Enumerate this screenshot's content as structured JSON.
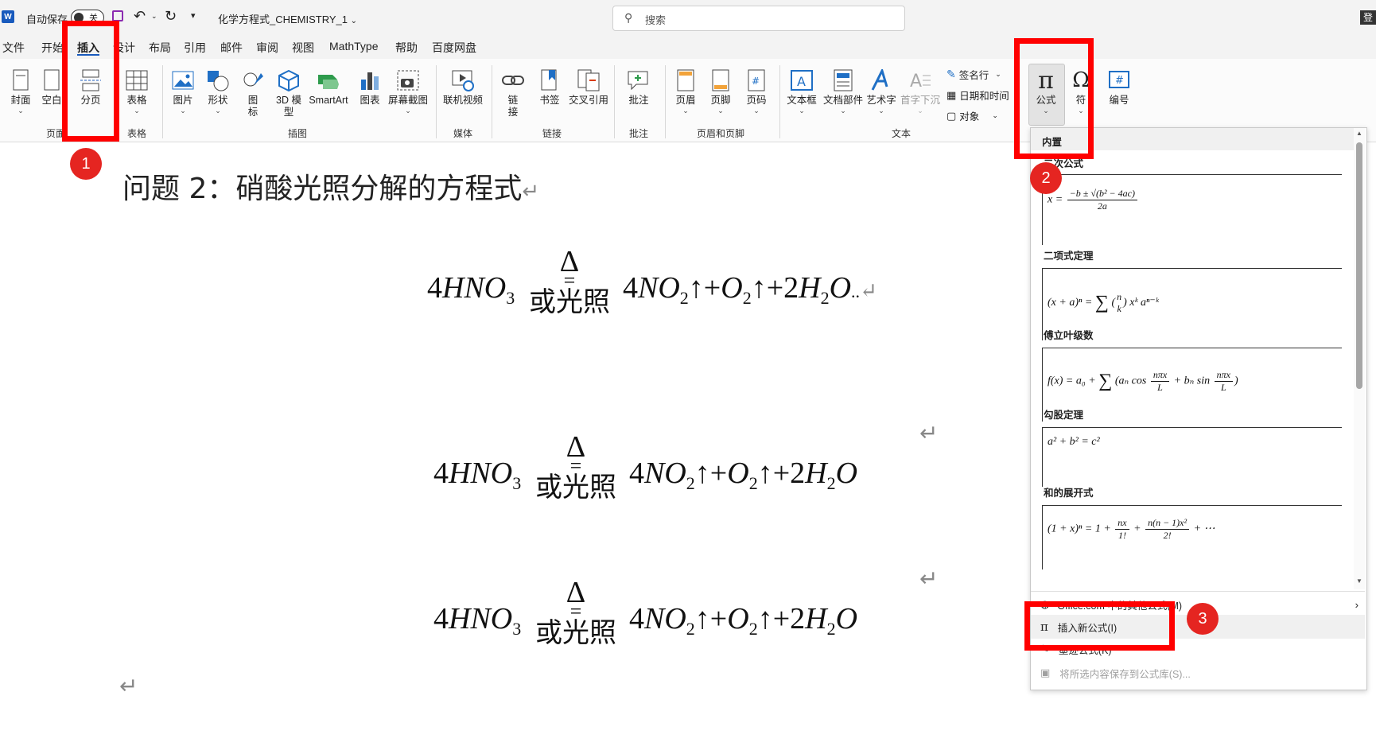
{
  "titlebar": {
    "autosave_label": "自动保存",
    "autosave_state": "关",
    "doc_title": "化学方程式_CHEMISTRY_1",
    "search_placeholder": "搜索",
    "login": "登"
  },
  "menu": {
    "items": [
      "文件",
      "开始",
      "插入",
      "设计",
      "布局",
      "引用",
      "邮件",
      "审阅",
      "视图",
      "MathType",
      "帮助",
      "百度网盘"
    ],
    "active": "插入"
  },
  "ribbon": {
    "buttons": {
      "cover": "封面",
      "blank": "空白",
      "pagebreak": "分页",
      "table": "表格",
      "picture": "图片",
      "shapes": "形状",
      "icons": "图\n标",
      "model3d": "3D 模\n型",
      "smartart": "SmartArt",
      "chart": "图表",
      "screenshot": "屏幕截图",
      "online_video": "联机视频",
      "link": "链\n接",
      "bookmark": "书签",
      "crossref": "交叉引用",
      "comment": "批注",
      "header": "页眉",
      "footer": "页脚",
      "pagenum": "页码",
      "textbox": "文本框",
      "quickparts": "文档部件",
      "wordart": "艺术字",
      "dropcap": "首字下沉",
      "signature": "签名行",
      "datetime": "日期和时间",
      "object": "对象",
      "equation": "公式",
      "symbol": "符",
      "number": "编号"
    },
    "groups": {
      "pages": "页面",
      "tables": "表格",
      "illustrations": "插图",
      "media": "媒体",
      "links": "链接",
      "comments": "批注",
      "header_footer": "页眉和页脚",
      "text": "文本"
    }
  },
  "document": {
    "heading": "问题 2：硝酸光照分解的方程式",
    "condition_top": "Δ",
    "condition_bottom": "或光照",
    "paragraph_mark": "↵",
    "eq1": {
      "reactant_coef": "4",
      "reactant": "HNO",
      "reactant_sub": "3",
      "p1_coef": "4",
      "p1": "NO",
      "p1_sub": "2",
      "arrow": "↑",
      "plus": "+",
      "p2": "O",
      "p2_sub": "2",
      "p3_coef": "2",
      "p3a": "H",
      "p3a_sub": "2",
      "p3b": "O",
      "trail": ".."
    }
  },
  "equation_panel": {
    "header": "内置",
    "sections": [
      {
        "title": "二次公式",
        "formula": "x = (−b ± √(b² − 4ac)) / 2a"
      },
      {
        "title": "二项式定理",
        "formula": "(x + a)ⁿ = Σ (n k) xᵏ aⁿ⁻ᵏ"
      },
      {
        "title": "傅立叶级数",
        "formula": "f(x) = a₀ + Σ (aₙ cos nπx/L + bₙ sin nπx/L)"
      },
      {
        "title": "勾股定理",
        "formula": "a² + b² = c²"
      },
      {
        "title": "和的展开式",
        "formula": "(1 + x)ⁿ = 1 + nx/1! + n(n−1)x²/2! + ⋯"
      }
    ],
    "menu": {
      "office_more": "Office.com 中的其他公式(M)",
      "insert_new": "插入新公式(I)",
      "ink": "墨迹公式(K)",
      "save_selection": "将所选内容保存到公式库(S)..."
    }
  },
  "annotations": {
    "badges": [
      "1",
      "2",
      "3"
    ],
    "color": "#ff0000"
  }
}
